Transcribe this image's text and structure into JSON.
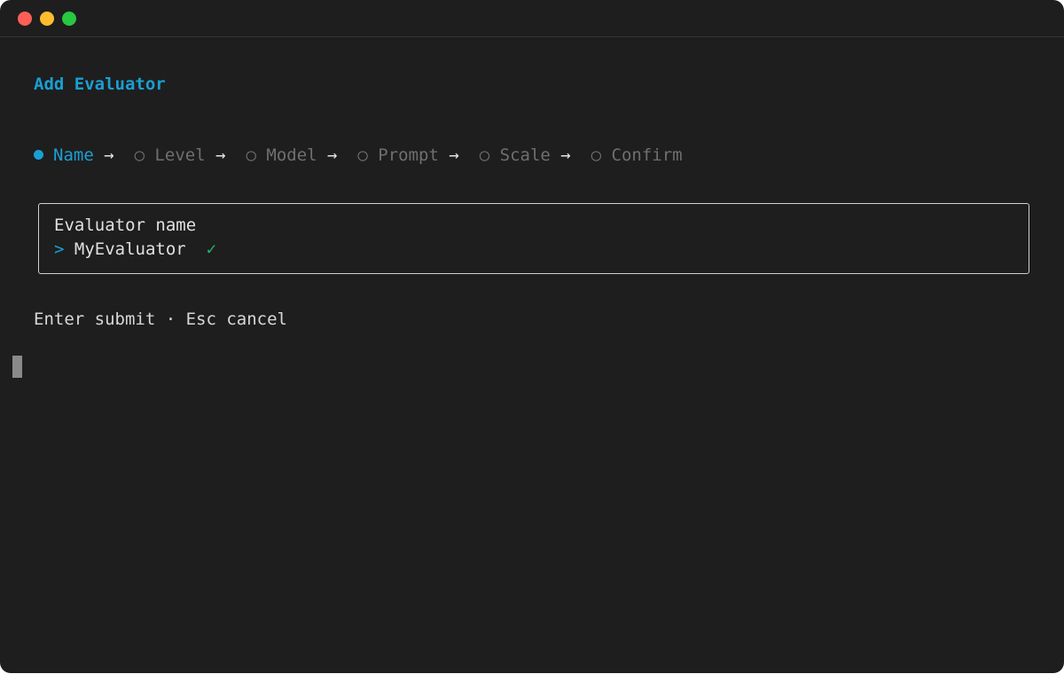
{
  "window": {
    "controls": [
      "close",
      "minimize",
      "zoom"
    ]
  },
  "heading": "Add Evaluator",
  "steps": [
    {
      "label": "Name",
      "active": true
    },
    {
      "label": "Level",
      "active": false
    },
    {
      "label": "Model",
      "active": false
    },
    {
      "label": "Prompt",
      "active": false
    },
    {
      "label": "Scale",
      "active": false
    },
    {
      "label": "Confirm",
      "active": false
    }
  ],
  "glyphs": {
    "arrow": "→",
    "inactive_bullet": "○",
    "caret": ">",
    "check": "✓"
  },
  "input": {
    "label": "Evaluator name",
    "value": "MyEvaluator"
  },
  "hint": "Enter submit · Esc cancel",
  "colors": {
    "accent": "#1a9fd4",
    "valid": "#22b573",
    "background": "#1e1e1e"
  }
}
